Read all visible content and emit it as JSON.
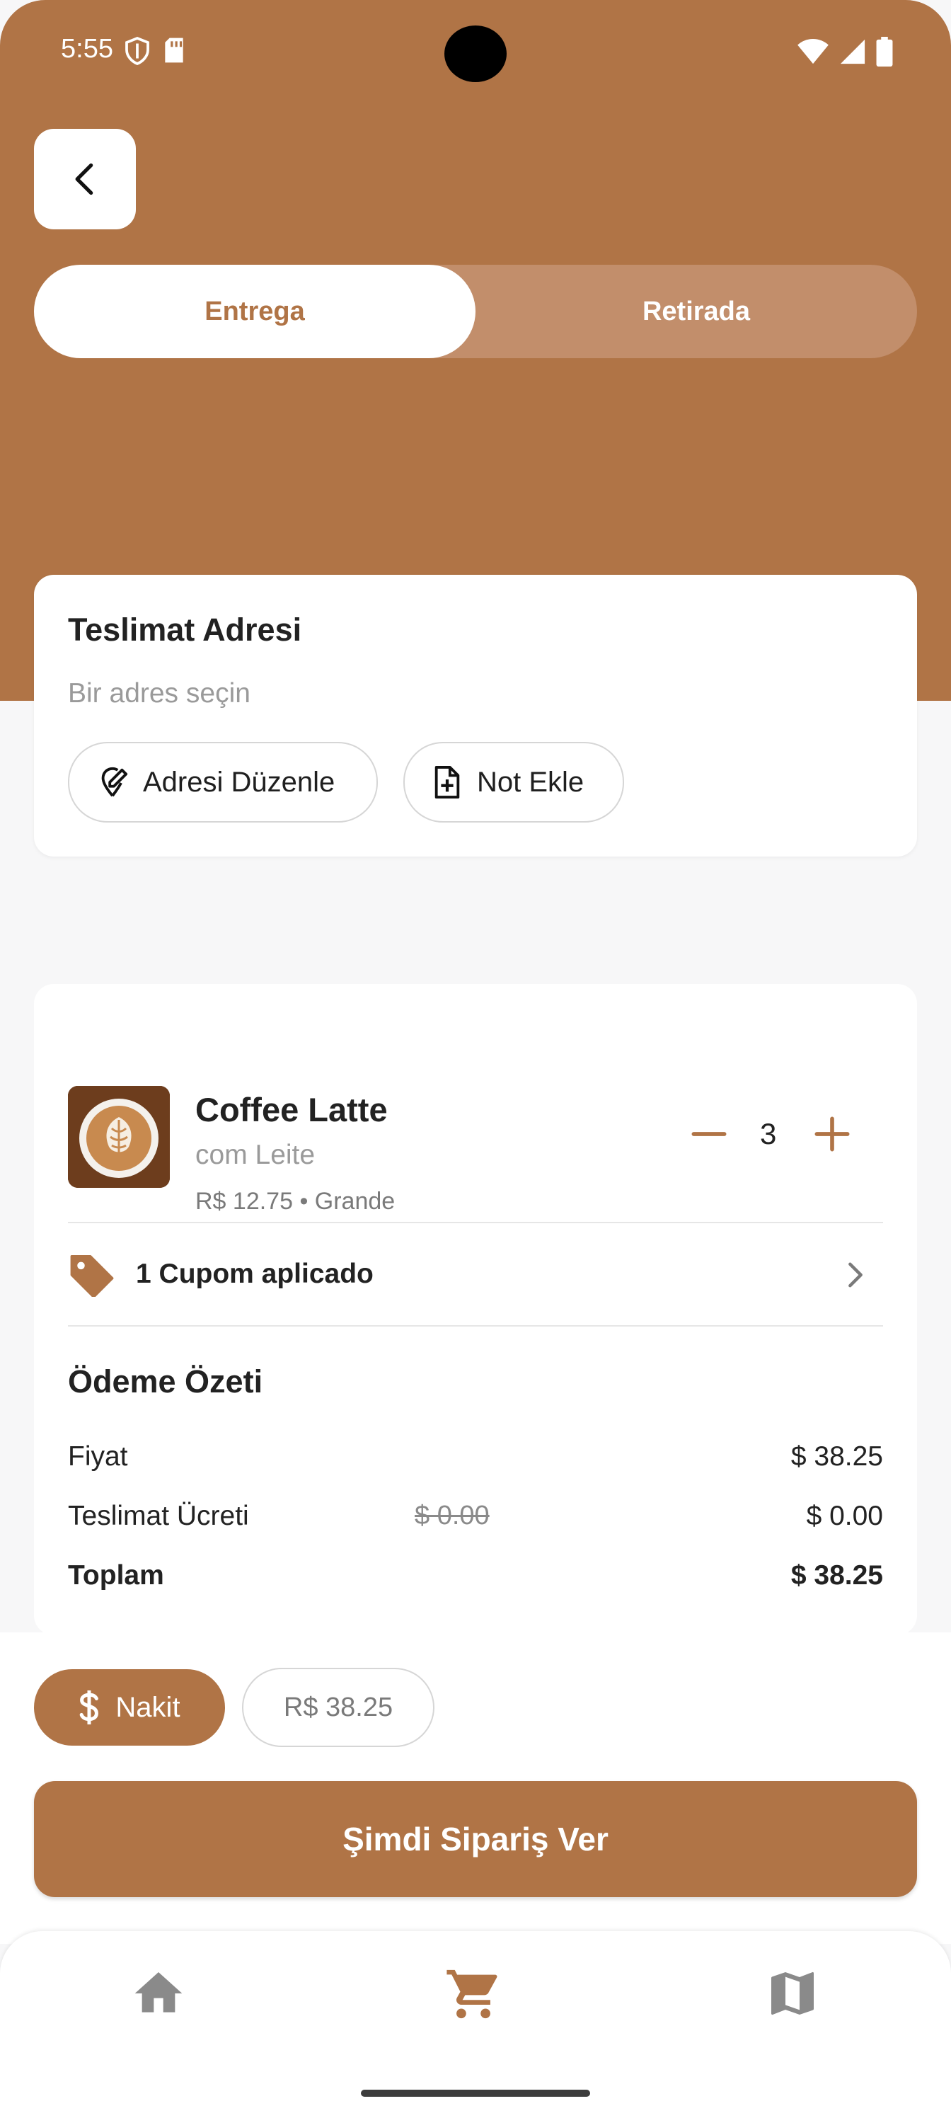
{
  "status_bar": {
    "time": "5:55"
  },
  "delivery_tabs": {
    "active_label": "Entrega",
    "inactive_label": "Retirada"
  },
  "address_card": {
    "title": "Teslimat Adresi",
    "placeholder": "Bir adres seçin",
    "edit_button": "Adresi Düzenle",
    "note_button": "Not Ekle"
  },
  "cart_item": {
    "name": "Coffee Latte",
    "subtitle": "com Leite",
    "meta": "R$ 12.75 • Grande",
    "quantity": "3"
  },
  "coupon": {
    "label": "1 Cupom aplicado"
  },
  "summary": {
    "title": "Ödeme Özeti",
    "price_label": "Fiyat",
    "price_value": "$ 38.25",
    "delivery_label": "Teslimat Ücreti",
    "delivery_original": "$ 0.00",
    "delivery_value": "$ 0.00",
    "total_label": "Toplam",
    "total_value": "$ 38.25"
  },
  "payment": {
    "method_label": "Nakit",
    "amount": "R$ 38.25"
  },
  "order_button": "Şimdi Sipariş Ver",
  "colors": {
    "accent": "#b07446",
    "accent_light": "#c28e6b",
    "background": "#f7f7f8"
  },
  "nav": {
    "items": [
      "home-icon",
      "cart-icon",
      "map-icon"
    ],
    "active": "cart-icon"
  }
}
